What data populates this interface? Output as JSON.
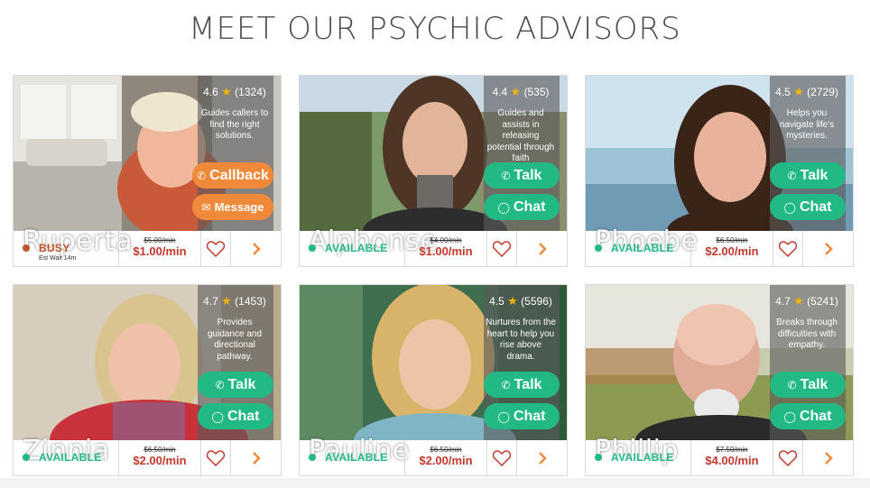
{
  "page": {
    "title": "MEET OUR PSYCHIC ADVISORS"
  },
  "colors": {
    "available": "#22b985",
    "busy": "#c0552b",
    "price": "#c0392b",
    "talk_chat": "#22b985",
    "callback_message": "#f08a3a",
    "arrow": "#f08a3a",
    "heart": "#c0392b"
  },
  "advisors": [
    {
      "name": "Ruperta",
      "rating": "4.6",
      "reviews": "(1324)",
      "description": "Guides callers to find the right solutions.",
      "status": "BUSY",
      "wait": "Est Wait 14m",
      "old_price": "$5.00/min",
      "price": "$1.00/min",
      "buttons": [
        "Callback",
        "Message"
      ]
    },
    {
      "name": "Alphonse",
      "rating": "4.4",
      "reviews": "(535)",
      "description": "Guides and assists in releasing potential through faith",
      "status": "AVAILABLE",
      "old_price": "$4.00/min",
      "price": "$1.00/min",
      "buttons": [
        "Talk",
        "Chat"
      ]
    },
    {
      "name": "Phoebe",
      "rating": "4.5",
      "reviews": "(2729)",
      "description": "Helps you navigate life's mysteries.",
      "status": "AVAILABLE",
      "old_price": "$6.50/min",
      "price": "$2.00/min",
      "buttons": [
        "Talk",
        "Chat"
      ]
    },
    {
      "name": "Zinnia",
      "rating": "4.7",
      "reviews": "(1453)",
      "description": "Provides guidance and directional pathway.",
      "status": "AVAILABLE",
      "old_price": "$6.50/min",
      "price": "$2.00/min",
      "buttons": [
        "Talk",
        "Chat"
      ]
    },
    {
      "name": "Pauline",
      "rating": "4.5",
      "reviews": "(5596)",
      "description": "Nurtures from the heart to help you rise above drama.",
      "status": "AVAILABLE",
      "old_price": "$6.50/min",
      "price": "$2.00/min",
      "buttons": [
        "Talk",
        "Chat"
      ]
    },
    {
      "name": "Phillip",
      "rating": "4.7",
      "reviews": "(5241)",
      "description": "Breaks through difficulties with empathy.",
      "status": "AVAILABLE",
      "old_price": "$7.50/min",
      "price": "$4.00/min",
      "buttons": [
        "Talk",
        "Chat"
      ]
    }
  ],
  "icons": {
    "rating": "star-icon",
    "talk": "phone-icon",
    "chat": "chat-bubble-icon",
    "callback": "phone-icon",
    "message": "envelope-icon",
    "favorite": "heart-icon",
    "profile": "chevron-right-icon"
  }
}
